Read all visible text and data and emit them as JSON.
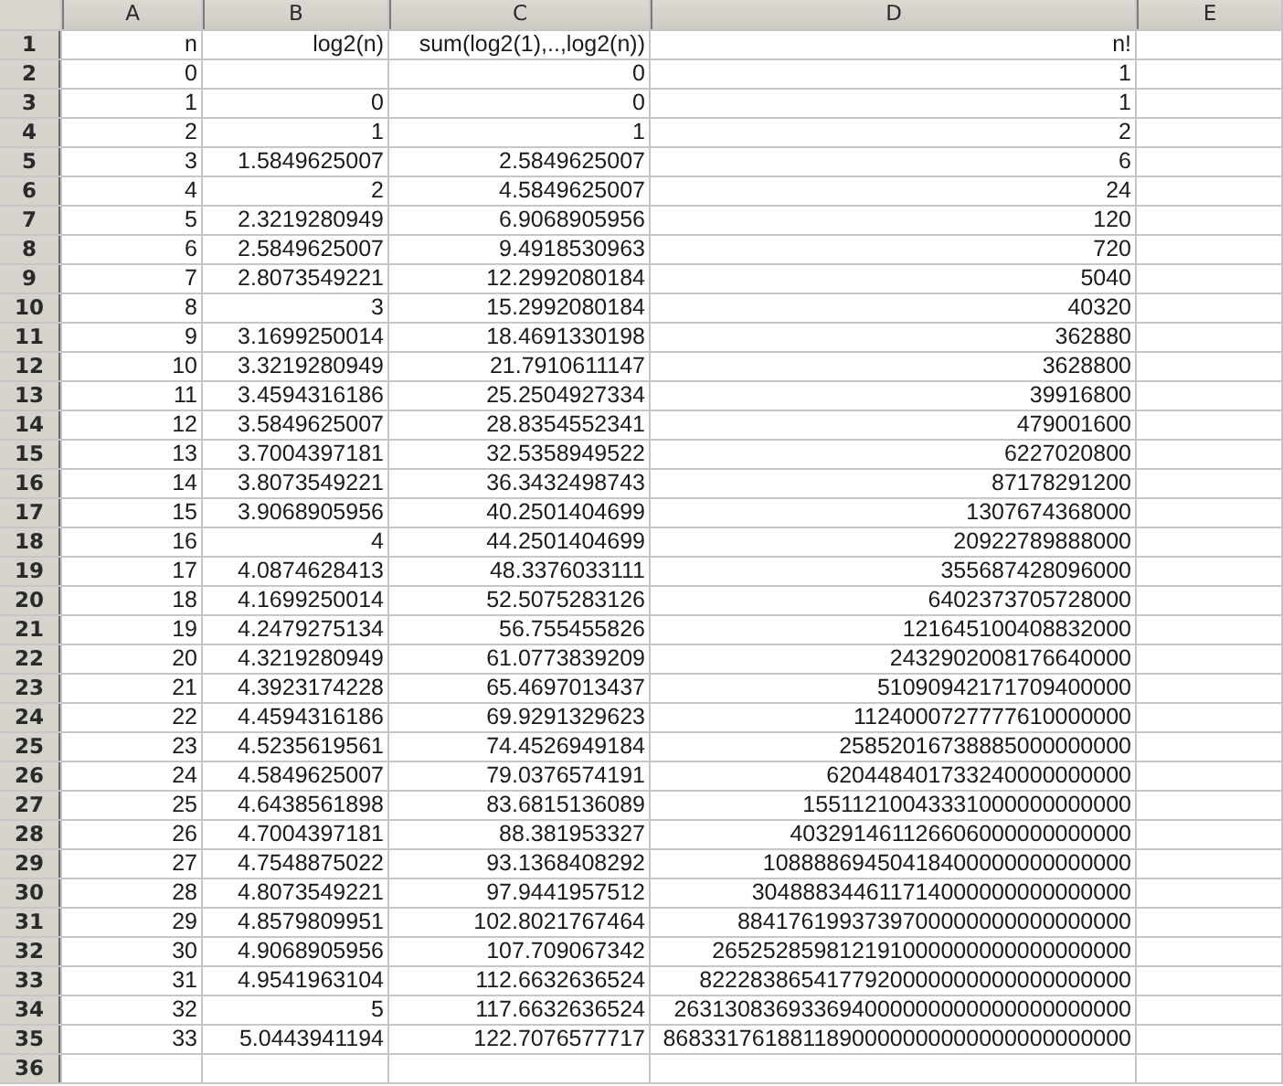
{
  "columns": [
    "A",
    "B",
    "C",
    "D",
    "E"
  ],
  "rows": [
    {
      "number": "1",
      "cells": [
        "n",
        "log2(n)",
        "sum(log2(1),..,log2(n))",
        "n!",
        null
      ]
    },
    {
      "number": "2",
      "cells": [
        "0",
        null,
        "0",
        "1",
        null
      ]
    },
    {
      "number": "3",
      "cells": [
        "1",
        "0",
        "0",
        "1",
        null
      ]
    },
    {
      "number": "4",
      "cells": [
        "2",
        "1",
        "1",
        "2",
        null
      ]
    },
    {
      "number": "5",
      "cells": [
        "3",
        "1.5849625007",
        "2.5849625007",
        "6",
        null
      ]
    },
    {
      "number": "6",
      "cells": [
        "4",
        "2",
        "4.5849625007",
        "24",
        null
      ]
    },
    {
      "number": "7",
      "cells": [
        "5",
        "2.3219280949",
        "6.9068905956",
        "120",
        null
      ]
    },
    {
      "number": "8",
      "cells": [
        "6",
        "2.5849625007",
        "9.4918530963",
        "720",
        null
      ]
    },
    {
      "number": "9",
      "cells": [
        "7",
        "2.8073549221",
        "12.2992080184",
        "5040",
        null
      ]
    },
    {
      "number": "10",
      "cells": [
        "8",
        "3",
        "15.2992080184",
        "40320",
        null
      ]
    },
    {
      "number": "11",
      "cells": [
        "9",
        "3.1699250014",
        "18.4691330198",
        "362880",
        null
      ]
    },
    {
      "number": "12",
      "cells": [
        "10",
        "3.3219280949",
        "21.7910611147",
        "3628800",
        null
      ]
    },
    {
      "number": "13",
      "cells": [
        "11",
        "3.4594316186",
        "25.2504927334",
        "39916800",
        null
      ]
    },
    {
      "number": "14",
      "cells": [
        "12",
        "3.5849625007",
        "28.8354552341",
        "479001600",
        null
      ]
    },
    {
      "number": "15",
      "cells": [
        "13",
        "3.7004397181",
        "32.5358949522",
        "6227020800",
        null
      ]
    },
    {
      "number": "16",
      "cells": [
        "14",
        "3.8073549221",
        "36.3432498743",
        "87178291200",
        null
      ]
    },
    {
      "number": "17",
      "cells": [
        "15",
        "3.9068905956",
        "40.2501404699",
        "1307674368000",
        null
      ]
    },
    {
      "number": "18",
      "cells": [
        "16",
        "4",
        "44.2501404699",
        "20922789888000",
        null
      ]
    },
    {
      "number": "19",
      "cells": [
        "17",
        "4.0874628413",
        "48.3376033111",
        "355687428096000",
        null
      ]
    },
    {
      "number": "20",
      "cells": [
        "18",
        "4.1699250014",
        "52.5075283126",
        "6402373705728000",
        null
      ]
    },
    {
      "number": "21",
      "cells": [
        "19",
        "4.2479275134",
        "56.755455826",
        "121645100408832000",
        null
      ]
    },
    {
      "number": "22",
      "cells": [
        "20",
        "4.3219280949",
        "61.0773839209",
        "2432902008176640000",
        null
      ]
    },
    {
      "number": "23",
      "cells": [
        "21",
        "4.3923174228",
        "65.4697013437",
        "51090942171709400000",
        null
      ]
    },
    {
      "number": "24",
      "cells": [
        "22",
        "4.4594316186",
        "69.9291329623",
        "1124000727777610000000",
        null
      ]
    },
    {
      "number": "25",
      "cells": [
        "23",
        "4.5235619561",
        "74.4526949184",
        "25852016738885000000000",
        null
      ]
    },
    {
      "number": "26",
      "cells": [
        "24",
        "4.5849625007",
        "79.0376574191",
        "620448401733240000000000",
        null
      ]
    },
    {
      "number": "27",
      "cells": [
        "25",
        "4.6438561898",
        "83.6815136089",
        "15511210043331000000000000",
        null
      ]
    },
    {
      "number": "28",
      "cells": [
        "26",
        "4.7004397181",
        "88.381953327",
        "403291461126606000000000000",
        null
      ]
    },
    {
      "number": "29",
      "cells": [
        "27",
        "4.7548875022",
        "93.1368408292",
        "10888869450418400000000000000",
        null
      ]
    },
    {
      "number": "30",
      "cells": [
        "28",
        "4.8073549221",
        "97.9441957512",
        "304888344611714000000000000000",
        null
      ]
    },
    {
      "number": "31",
      "cells": [
        "29",
        "4.8579809951",
        "102.8021767464",
        "8841761993739700000000000000000",
        null
      ]
    },
    {
      "number": "32",
      "cells": [
        "30",
        "4.9068905956",
        "107.709067342",
        "265252859812191000000000000000000",
        null
      ]
    },
    {
      "number": "33",
      "cells": [
        "31",
        "4.9541963104",
        "112.6632636524",
        "8222838654177920000000000000000000",
        null
      ]
    },
    {
      "number": "34",
      "cells": [
        "32",
        "5",
        "117.6632636524",
        "263130836933694000000000000000000000",
        null
      ]
    },
    {
      "number": "35",
      "cells": [
        "33",
        "5.0443941194",
        "122.7076577717",
        "8683317618811890000000000000000000000",
        null
      ]
    },
    {
      "number": "36",
      "cells": [
        null,
        null,
        null,
        null,
        null
      ]
    }
  ]
}
